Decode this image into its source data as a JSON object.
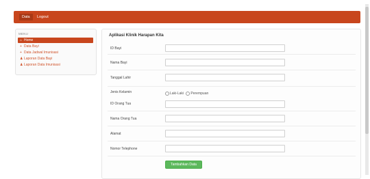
{
  "topbar": {
    "items": [
      "Data",
      "Logout"
    ]
  },
  "sidebar": {
    "header": "MENU",
    "items": [
      {
        "label": "Home",
        "icon": "home-icon"
      },
      {
        "label": "Data Bayi",
        "icon": "plus-icon"
      },
      {
        "label": "Data Jadwal Imunisasi",
        "icon": "plus-icon"
      },
      {
        "label": "Laporan Data Bayi",
        "icon": "user-icon"
      },
      {
        "label": "Laporan Data Imunisasi",
        "icon": "user-icon"
      }
    ]
  },
  "form": {
    "title": "Aplikasi Klinik Harapan Kita",
    "fields": [
      {
        "label": "ID Bayi",
        "value": ""
      },
      {
        "label": "Nama Bayi",
        "value": ""
      },
      {
        "label": "Tanggal Lahir",
        "value": ""
      },
      {
        "label": "Jenis Kelamin",
        "options": [
          "Laki-Laki",
          "Perempuan"
        ]
      },
      {
        "label": "ID Orang Tua",
        "value": ""
      },
      {
        "label": "Nama Orang Tua",
        "value": ""
      },
      {
        "label": "Alamat",
        "value": ""
      },
      {
        "label": "Nomor Telephone",
        "value": ""
      }
    ],
    "submit_label": "Tambahkan Data"
  },
  "colors": {
    "accent": "#c8461d",
    "submit": "#5cb85c"
  }
}
